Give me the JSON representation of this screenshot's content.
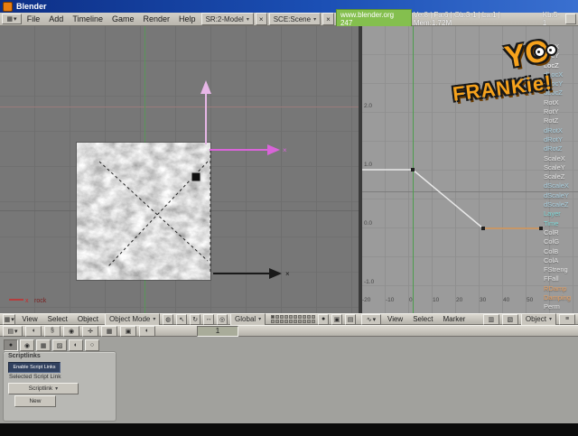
{
  "titlebar": {
    "title": "Blender"
  },
  "menubar": {
    "menus": [
      "File",
      "Add",
      "Timeline",
      "Game",
      "Render",
      "Help"
    ],
    "screen_selector": "SR:2-Model",
    "scene_selector": "SCE:Scene",
    "close_glyph": "×",
    "version_chip": "www.blender.org 247",
    "stats": "Ve:8 | Fa:6 | Ob:3-1 | La:1 | Mem:1.72M",
    "stats_right": "Kb:5-1"
  },
  "logo": {
    "top": "YO",
    "bottom": "FRANKie!"
  },
  "viewport": {
    "object_label": "rock",
    "gizmo_axis_label": "x"
  },
  "viewport_header": {
    "menus": [
      "View",
      "Select",
      "Object"
    ],
    "mode": "Object Mode",
    "orientation": "Global"
  },
  "ipo": {
    "y_ticks": [
      "2.0",
      "1.0",
      "0.0",
      "-1.0"
    ],
    "x_ticks": [
      "-20",
      "-10",
      "0",
      "10",
      "20",
      "30",
      "40",
      "50"
    ],
    "frame_line_color": "#4d9d4d",
    "curve": {
      "selected_channel": "LocZ",
      "white_segment": [
        {
          "frame": -20,
          "value": 1.0
        },
        {
          "frame": 0,
          "value": 1.0
        },
        {
          "frame": 30,
          "value": 0.0
        }
      ],
      "extrapolation_segment": [
        {
          "frame": 30,
          "value": 0.0
        },
        {
          "frame": 55,
          "value": 0.0
        }
      ],
      "white_color": "#e9e9e9",
      "extrapolation_color": "#d89858"
    },
    "channels": [
      {
        "label": "LocX",
        "color": "#e6e6e6"
      },
      {
        "label": "LocY",
        "color": "#e6e6e6"
      },
      {
        "label": "LocZ",
        "color": "#ffffff"
      },
      {
        "label": "dLocX",
        "color": "#a8cede"
      },
      {
        "label": "dLocY",
        "color": "#a8cede"
      },
      {
        "label": "dLocZ",
        "color": "#a8cede"
      },
      {
        "label": "RotX",
        "color": "#e6e6e6"
      },
      {
        "label": "RotY",
        "color": "#e6e6e6"
      },
      {
        "label": "RotZ",
        "color": "#e6e6e6"
      },
      {
        "label": "dRotX",
        "color": "#a8cede"
      },
      {
        "label": "dRotY",
        "color": "#a8cede"
      },
      {
        "label": "dRotZ",
        "color": "#a8cede"
      },
      {
        "label": "ScaleX",
        "color": "#e6e6e6"
      },
      {
        "label": "ScaleY",
        "color": "#e6e6e6"
      },
      {
        "label": "ScaleZ",
        "color": "#e6e6e6"
      },
      {
        "label": "dScaleX",
        "color": "#a8cede"
      },
      {
        "label": "dScaleY",
        "color": "#a8cede"
      },
      {
        "label": "dScaleZ",
        "color": "#a8cede"
      },
      {
        "label": "Layer",
        "color": "#7fd8d8"
      },
      {
        "label": "Time",
        "color": "#7fd8d8"
      },
      {
        "label": "ColR",
        "color": "#e6e6e6"
      },
      {
        "label": "ColG",
        "color": "#e6e6e6"
      },
      {
        "label": "ColB",
        "color": "#e6e6e6"
      },
      {
        "label": "ColA",
        "color": "#e6e6e6"
      },
      {
        "label": "FStreng",
        "color": "#e6e6e6"
      },
      {
        "label": "FFall",
        "color": "#e6e6e6"
      },
      {
        "label": "RDamp",
        "color": "#e8a060"
      },
      {
        "label": "Damping",
        "color": "#e8a060"
      },
      {
        "label": "Perm",
        "color": "#e6e6e6"
      }
    ]
  },
  "ipo_header": {
    "menus": [
      "View",
      "Select",
      "Marker"
    ],
    "ipo_type": "Object"
  },
  "buttons_header": {
    "frame": "1"
  },
  "buttons_panel": {
    "tab": "Scriptlinks",
    "enable_toggle": "Enable Script Links",
    "selected_label": "Selected Script Link",
    "link_type": "Scriptlink",
    "new_button": "New"
  },
  "colors": {
    "viewport_bg": "#777777",
    "ipo_bg": "#9b9b9b",
    "axis_green": "#579657",
    "axis_red": "#9b7c7c",
    "logo_orange": "#f6a21c"
  }
}
